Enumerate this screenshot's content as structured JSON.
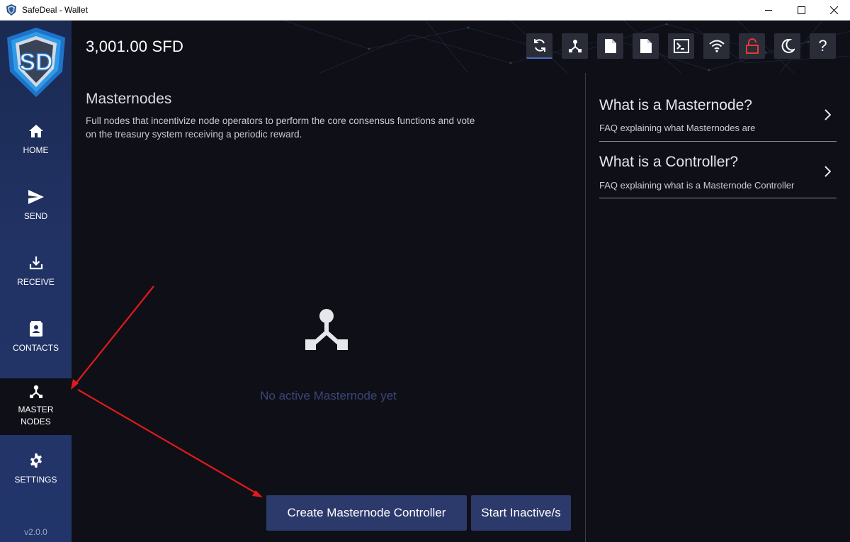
{
  "window": {
    "title": "SafeDeal - Wallet",
    "controls": [
      "minimize-icon",
      "maximize-icon",
      "close-icon"
    ]
  },
  "header": {
    "balance": "3,001.00 SFD",
    "toolbar": [
      {
        "icon": "sync-icon",
        "active": true
      },
      {
        "icon": "masternode-icon"
      },
      {
        "icon": "document-icon"
      },
      {
        "icon": "document-icon"
      },
      {
        "icon": "terminal-icon"
      },
      {
        "icon": "wifi-icon"
      },
      {
        "icon": "unlock-icon",
        "color": "#e53935"
      },
      {
        "icon": "moon-icon"
      },
      {
        "icon": "help-icon",
        "label": "?"
      }
    ]
  },
  "sidebar": {
    "logo_text": "SD",
    "items": [
      {
        "label": "HOME",
        "icon": "home-icon"
      },
      {
        "label": "SEND",
        "icon": "send-icon"
      },
      {
        "label": "RECEIVE",
        "icon": "download-icon"
      },
      {
        "label": "CONTACTS",
        "icon": "contacts-icon"
      },
      {
        "label": "MASTER\nNODES",
        "icon": "masternode-icon",
        "active": true
      },
      {
        "label": "SETTINGS",
        "icon": "gear-icon"
      }
    ],
    "version": "v2.0.0"
  },
  "main": {
    "title": "Masternodes",
    "description": "Full nodes that incentivize node operators to perform the core consensus functions and vote on the treasury system receiving a periodic reward.",
    "empty_text": "No active Masternode yet",
    "buttons": {
      "create": "Create Masternode Controller",
      "start": "Start Inactive/s"
    }
  },
  "faq": [
    {
      "title": "What is a Masternode?",
      "subtitle": "FAQ explaining what Masternodes are"
    },
    {
      "title": "What is a Controller?",
      "subtitle": "FAQ explaining what is a Masternode Controller"
    }
  ],
  "colors": {
    "background": "#0f0f17",
    "sidebar": "#213263",
    "button": "#2c3a6b",
    "empty_text": "#3a4677",
    "annotation": "#e3191b"
  }
}
